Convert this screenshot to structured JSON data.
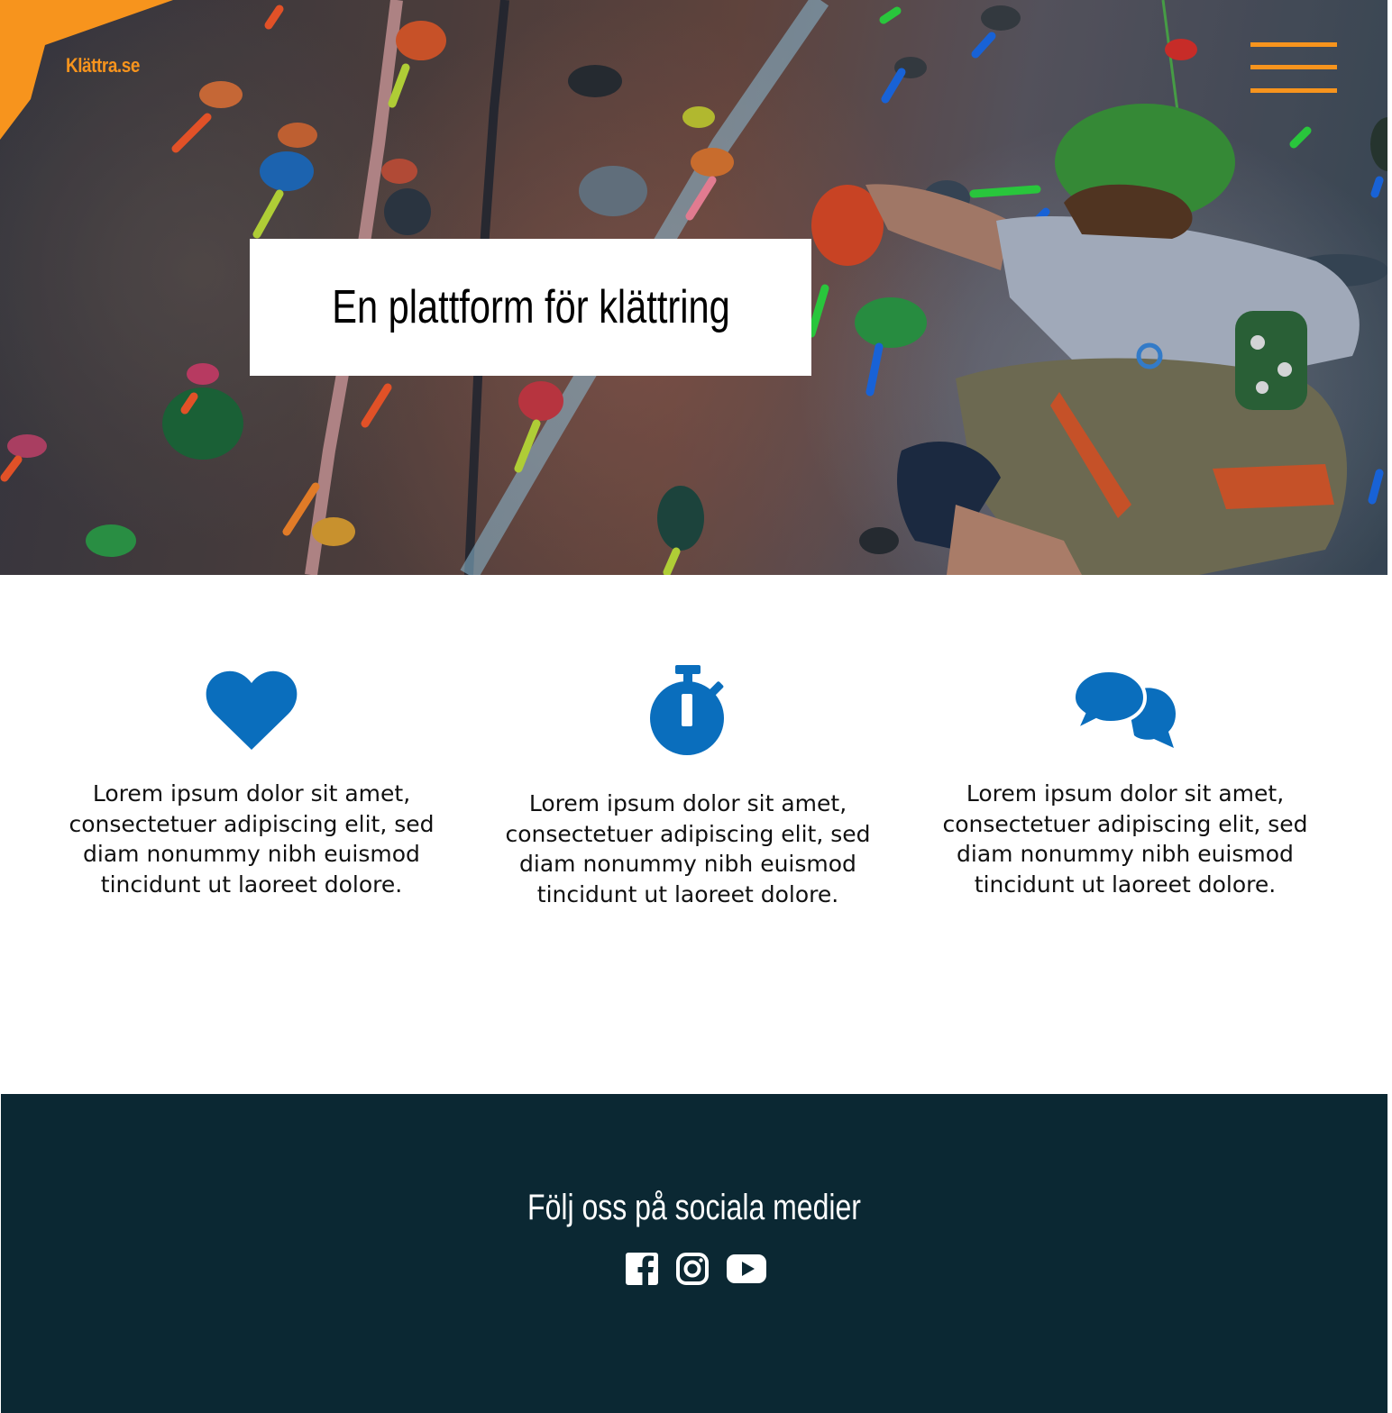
{
  "header": {
    "logo_text": "Klättra.se",
    "menu_icon": "hamburger-menu-icon",
    "accent_color": "#f7941d"
  },
  "hero": {
    "title": "En plattform för klättring",
    "image": "indoor-climbing-wall-photo"
  },
  "features": [
    {
      "icon": "heart-icon",
      "text": "Lorem ipsum dolor sit amet, consectetuer adipiscing elit, sed diam nonummy nibh euismod tincidunt ut laoreet dolore."
    },
    {
      "icon": "stopwatch-icon",
      "text": "Lorem ipsum dolor sit amet, consectetuer adipiscing elit, sed diam nonummy nibh euismod tincidunt ut laoreet dolore."
    },
    {
      "icon": "chat-bubbles-icon",
      "text": "Lorem ipsum dolor sit amet, consectetuer adipiscing elit, sed diam nonummy nibh euismod tincidunt ut laoreet dolore."
    }
  ],
  "icon_color": "#0a6ebd",
  "footer": {
    "title": "Följ oss på sociala medier",
    "background_color": "#0b2833",
    "social": [
      {
        "icon": "facebook-icon"
      },
      {
        "icon": "instagram-icon"
      },
      {
        "icon": "youtube-icon"
      }
    ]
  }
}
